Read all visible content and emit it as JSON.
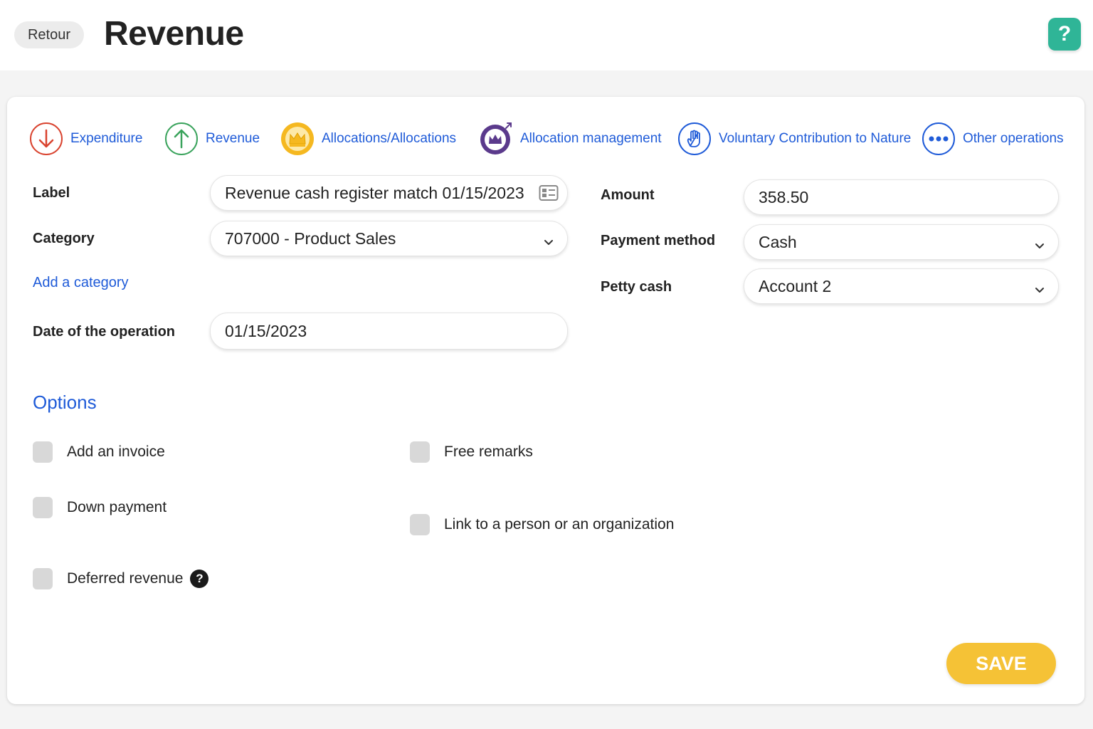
{
  "header": {
    "back_label": "Retour",
    "title": "Revenue",
    "help_label": "?"
  },
  "operations": [
    {
      "label": "Expenditure",
      "icon": "arrow-down-icon",
      "color": "#d9432f"
    },
    {
      "label": "Revenue",
      "icon": "arrow-up-icon",
      "color": "#3aa35c"
    },
    {
      "label": "Allocations/Allocations",
      "icon": "crown-icon",
      "color": "#f5b820"
    },
    {
      "label": "Allocation management",
      "icon": "crown-arrow-icon",
      "color": "#5b3a8c"
    },
    {
      "label": "Voluntary Contribution to Nature",
      "icon": "hand-icon",
      "color": "#1f5bd8"
    },
    {
      "label": "Other operations",
      "icon": "dots-icon",
      "color": "#1f5bd8"
    }
  ],
  "form": {
    "label": {
      "label": "Label",
      "value": "Revenue cash register match 01/15/2023"
    },
    "category": {
      "label": "Category",
      "value": "707000 - Product Sales"
    },
    "add_category": "Add a category",
    "date": {
      "label": "Date of the operation",
      "value": "01/15/2023"
    },
    "amount": {
      "label": "Amount",
      "value": "358.50"
    },
    "payment_method": {
      "label": "Payment method",
      "value": "Cash"
    },
    "petty_cash": {
      "label": "Petty cash",
      "value": "Account 2"
    }
  },
  "options": {
    "title": "Options",
    "items": [
      {
        "label": "Add an invoice",
        "checked": false
      },
      {
        "label": "Down payment",
        "checked": false
      },
      {
        "label": "Deferred revenue",
        "checked": false,
        "help": "?"
      },
      {
        "label": "Free remarks",
        "checked": false
      },
      {
        "label": "Link to a person or an organization",
        "checked": false
      }
    ]
  },
  "save_label": "SAVE",
  "colors": {
    "accent_blue": "#1f5bd8",
    "help_green": "#2fb597",
    "save_yellow": "#f5c236"
  }
}
